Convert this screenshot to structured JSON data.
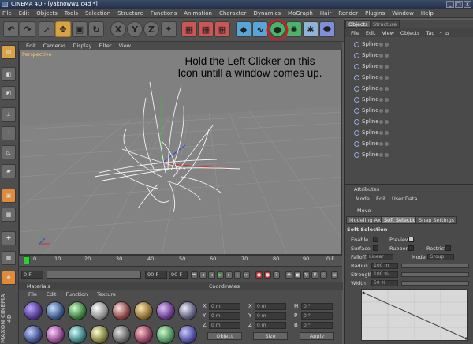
{
  "window": {
    "title": "CINEMA 4D - [yaknoww1.c4d *]",
    "buttons": [
      "_",
      "□",
      "x"
    ]
  },
  "menubar": [
    "File",
    "Edit",
    "Objects",
    "Tools",
    "Selection",
    "Structure",
    "Functions",
    "Animation",
    "Character",
    "Dynamics",
    "MoGraph",
    "Hair",
    "Render",
    "Plugins",
    "Window",
    "Help"
  ],
  "toolbar": {
    "xyz": [
      "X",
      "Y",
      "Z"
    ]
  },
  "viewport": {
    "menu": [
      "Edit",
      "Cameras",
      "Display",
      "Filter",
      "View"
    ],
    "label": "Perspective",
    "annotation_line1": "Hold the Left Clicker on this",
    "annotation_line2": "Icon untill a window comes up."
  },
  "timeline": {
    "ticks": [
      "0",
      "10",
      "20",
      "30",
      "40",
      "50",
      "60",
      "70",
      "80",
      "90",
      "0 F"
    ]
  },
  "playbar": {
    "start": "0 F",
    "current": "90 F",
    "end": "90 F"
  },
  "materials": {
    "title": "Materials",
    "menu": [
      "File",
      "Edit",
      "Function",
      "Texture"
    ]
  },
  "coordinates": {
    "title": "Coordinates",
    "axes": [
      "X",
      "Y",
      "Z"
    ],
    "size_axes": [
      "X",
      "Y",
      "Z"
    ],
    "rot_labels": [
      "H",
      "P",
      "B"
    ],
    "pos_value": "0 m",
    "rot_value": "0 °",
    "mode_object": "Object",
    "mode_size": "Size",
    "apply": "Apply"
  },
  "objects": {
    "tabs": [
      "Objects",
      "Structure"
    ],
    "menu": [
      "File",
      "Edit",
      "View",
      "Objects",
      "Tag"
    ],
    "items": [
      "Spline",
      "Spline",
      "Spline",
      "Spline",
      "Spline",
      "Spline",
      "Spline",
      "Spline",
      "Spline",
      "Spline",
      "Spline"
    ]
  },
  "attributes": {
    "title": "Attributes",
    "menu": [
      "Mode",
      "Edit",
      "User Data"
    ],
    "tool": "Move",
    "tabs": [
      "Modeling Axis",
      "Soft Selection",
      "Snap Settings"
    ],
    "section": "Soft Selection",
    "enable": "Enable",
    "preview": "Preview",
    "surface": "Surface",
    "rubber": "Rubber",
    "restrict": "Restrict",
    "falloff_label": "Falloff",
    "falloff_value": "Linear",
    "mode_label": "Mode",
    "mode_value": "Group",
    "radius_label": "Radius",
    "radius_value": "100 m",
    "strength_label": "Strength",
    "strength_value": "100 %",
    "width_label": "Width",
    "width_value": "50 %"
  },
  "maxon_logo": "MAXON CINEMA 4D"
}
